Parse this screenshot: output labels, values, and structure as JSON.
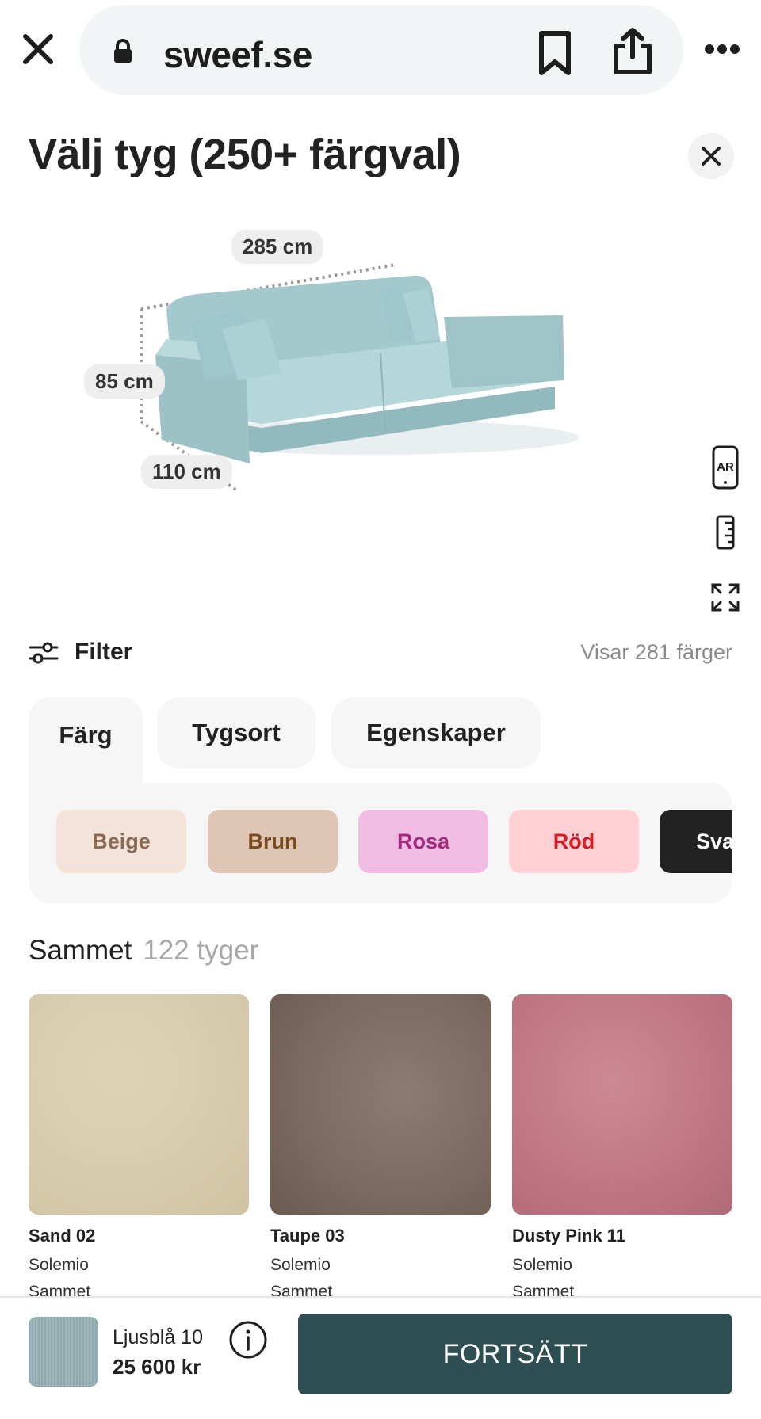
{
  "browser": {
    "url": "sweef.se",
    "icons": [
      "close-icon",
      "lock-icon",
      "bookmark-icon",
      "share-icon",
      "more-icon"
    ]
  },
  "modal": {
    "title": "Välj tyg (250+ färgval)",
    "close_icon": "close-icon"
  },
  "product_view": {
    "dimensions": {
      "width": "285 cm",
      "height": "85 cm",
      "depth": "110 cm"
    },
    "tools": [
      "ar-icon",
      "ruler-icon",
      "fullscreen-icon"
    ],
    "ar_label": "AR",
    "sofa_color": "#a9ced1"
  },
  "filter": {
    "label": "Filter",
    "result_count": "Visar 281 färger"
  },
  "tabs": [
    {
      "label": "Färg",
      "active": true
    },
    {
      "label": "Tygsort",
      "active": false
    },
    {
      "label": "Egenskaper",
      "active": false
    }
  ],
  "color_chips": [
    {
      "label": "Beige",
      "bg": "#f3e3d8",
      "fg": "#8a6a55"
    },
    {
      "label": "Brun",
      "bg": "#dfc6b4",
      "fg": "#7a4a1c"
    },
    {
      "label": "Rosa",
      "bg": "#efbde3",
      "fg": "#a6297f"
    },
    {
      "label": "Röd",
      "bg": "#ffd0d4",
      "fg": "#d91c24"
    },
    {
      "label": "Sva",
      "bg": "#222222",
      "fg": "#ffffff"
    }
  ],
  "section": {
    "title": "Sammet",
    "count": "122 tyger"
  },
  "fabrics": [
    {
      "name": "Sand 02",
      "brand": "Solemio",
      "type": "Sammet",
      "color": "#d8ceb0"
    },
    {
      "name": "Taupe 03",
      "brand": "Solemio",
      "type": "Sammet",
      "color": "#7f6d63"
    },
    {
      "name": "Dusty Pink 11",
      "brand": "Solemio",
      "type": "Sammet",
      "color": "#c07884"
    }
  ],
  "selection": {
    "name": "Ljusblå 10",
    "price": "25 600 kr",
    "button_label": "FORTSÄTT",
    "button_color": "#2e4e52"
  }
}
